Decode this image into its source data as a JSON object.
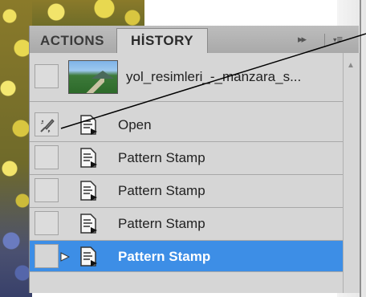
{
  "panel": {
    "tabs": [
      {
        "label": "ACTIONS"
      },
      {
        "label": "HİSTORY"
      }
    ],
    "collapse_glyph": "▸▸",
    "menu_glyph": "≡"
  },
  "snapshot": {
    "label": "yol_resimleri_-_manzara_s..."
  },
  "history": {
    "items": [
      {
        "label": "Open"
      },
      {
        "label": "Pattern Stamp"
      },
      {
        "label": "Pattern Stamp"
      },
      {
        "label": "Pattern Stamp"
      },
      {
        "label": "Pattern Stamp"
      }
    ],
    "selected_index": 4
  },
  "colors": {
    "selection": "#3d8ee6",
    "panel_bg": "#d6d6d6",
    "tabbar_bg": "#b3b3b3"
  }
}
